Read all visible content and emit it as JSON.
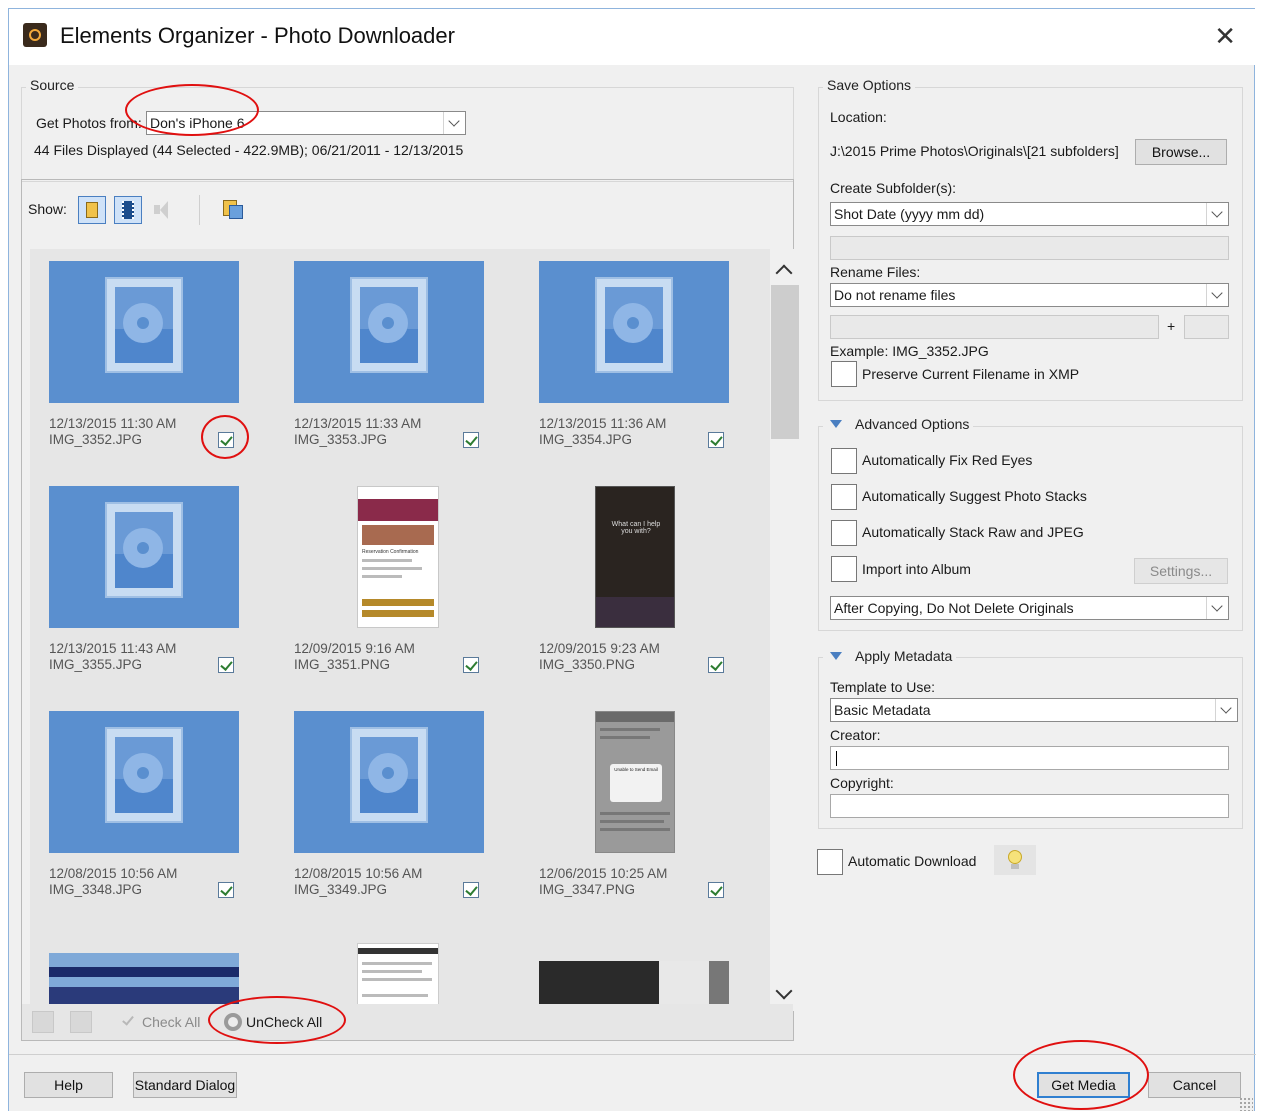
{
  "window": {
    "title": "Elements Organizer - Photo Downloader",
    "close_glyph": "✕"
  },
  "source": {
    "legend": "Source",
    "get_photos_label": "Get Photos from:",
    "device_value": "Don's iPhone 6",
    "summary": "44 Files Displayed (44 Selected - 422.9MB); 06/21/2011 - 12/13/2015"
  },
  "show_bar": {
    "label": "Show:",
    "icons": [
      "photo-filter-icon",
      "video-filter-icon",
      "audio-filter-icon",
      "file-filter-icon"
    ]
  },
  "thumbnails": [
    {
      "date": "12/13/2015 11:30 AM",
      "file": "IMG_3352.JPG",
      "checked": true
    },
    {
      "date": "12/13/2015 11:33 AM",
      "file": "IMG_3353.JPG",
      "checked": true
    },
    {
      "date": "12/13/2015 11:36 AM",
      "file": "IMG_3354.JPG",
      "checked": true
    },
    {
      "date": "12/13/2015 11:43 AM",
      "file": "IMG_3355.JPG",
      "checked": true
    },
    {
      "date": "12/09/2015 9:16 AM",
      "file": "IMG_3351.PNG",
      "checked": true,
      "preview_text": "Reservation Confirmation"
    },
    {
      "date": "12/09/2015 9:23 AM",
      "file": "IMG_3350.PNG",
      "checked": true,
      "preview_text": "What can I help you with?"
    },
    {
      "date": "12/08/2015 10:56 AM",
      "file": "IMG_3348.JPG",
      "checked": true
    },
    {
      "date": "12/08/2015 10:56 AM",
      "file": "IMG_3349.JPG",
      "checked": true
    },
    {
      "date": "12/06/2015 10:25 AM",
      "file": "IMG_3347.PNG",
      "checked": true,
      "preview_text": "Unable to Send Email"
    }
  ],
  "bottom_bar": {
    "check_all": "Check All",
    "uncheck_all": "UnCheck All"
  },
  "save_options": {
    "legend": "Save Options",
    "location_label": "Location:",
    "location_value": "J:\\2015 Prime Photos\\Originals\\[21 subfolders]",
    "browse": "Browse...",
    "subfolder_label": "Create Subfolder(s):",
    "subfolder_value": "Shot Date (yyyy mm dd)",
    "rename_label": "Rename Files:",
    "rename_value": "Do not rename files",
    "plus": "+",
    "example": "Example:  IMG_3352.JPG",
    "preserve": "Preserve Current Filename in XMP"
  },
  "advanced": {
    "legend": "Advanced Options",
    "red_eyes": "Automatically Fix Red Eyes",
    "photo_stacks": "Automatically Suggest Photo Stacks",
    "stack_raw": "Automatically Stack Raw and JPEG",
    "import_album": "Import into Album",
    "settings": "Settings...",
    "after_copy": "After Copying, Do Not Delete Originals"
  },
  "metadata": {
    "legend": "Apply Metadata",
    "template_label": "Template to Use:",
    "template_value": "Basic Metadata",
    "creator_label": "Creator:",
    "copyright_label": "Copyright:"
  },
  "auto_download": "Automatic Download",
  "footer": {
    "help": "Help",
    "standard_dialog": "Standard Dialog",
    "get_media": "Get Media",
    "cancel": "Cancel"
  },
  "colors": {
    "accent": "#2f7fd0",
    "annotation": "#e01010",
    "check": "#2e7d32"
  }
}
